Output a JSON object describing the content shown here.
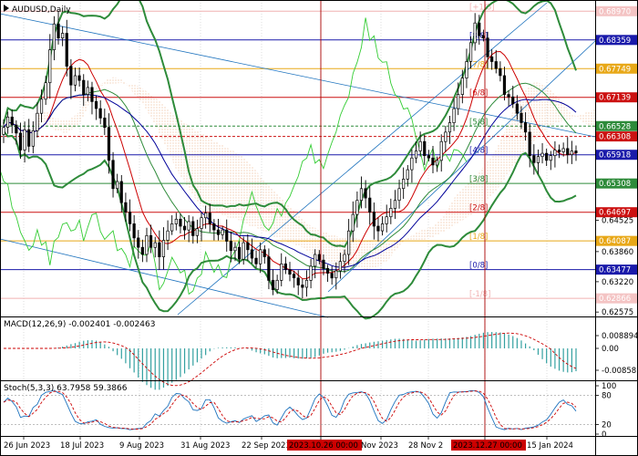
{
  "window": {
    "symbol_title": "AUDUSD,Daily",
    "macd_title": "MACD(12,26,9) -0.002401 -0.002463",
    "stoch_title": "Stoch(5,3,3) 63.7958 59.3866"
  },
  "colors": {
    "grid": "#c8c8c8",
    "bull": "#000000",
    "bear": "#000000",
    "fast_ma": "#cc0000",
    "slow_ma": "#000099",
    "bollinger": "#2e8b3a",
    "chikou": "#33cc33",
    "channel": "#1e73be",
    "cloud": "#e8a070",
    "macd_hist": "#33a0a0",
    "macd_signal": "#cc0000",
    "stoch_main": "#1e73be",
    "stoch_signal": "#cc0000",
    "vline": "#aa0000",
    "date_tag_bg": "#cc0000"
  },
  "price_axis": {
    "ticks": [
      "0.68970",
      "0.68359",
      "0.67749",
      "0.67139",
      "0.66528",
      "0.66308",
      "0.65918",
      "0.65308",
      "0.64697",
      "0.64525",
      "0.64087",
      "0.63860",
      "0.63477",
      "0.63220",
      "0.62866",
      "0.62575"
    ]
  },
  "price_tags": [
    {
      "label": "0.68970",
      "value": 0.6897,
      "bg": "#f4c4c4",
      "fg": "#ffffff"
    },
    {
      "label": "0.68359",
      "value": 0.68359,
      "bg": "#1a1aaa",
      "fg": "#ffffff"
    },
    {
      "label": "0.67749",
      "value": 0.67749,
      "bg": "#e8a818",
      "fg": "#ffffff"
    },
    {
      "label": "0.67139",
      "value": 0.67139,
      "bg": "#cc1111",
      "fg": "#ffffff"
    },
    {
      "label": "0.66528",
      "value": 0.66528,
      "bg": "#2e8b3a",
      "fg": "#ffffff"
    },
    {
      "label": "0.66308",
      "value": 0.66308,
      "bg": "#cc1111",
      "fg": "#ffffff"
    },
    {
      "label": "0.65918",
      "value": 0.65918,
      "bg": "#1a1aaa",
      "fg": "#ffffff"
    },
    {
      "label": "0.65308",
      "value": 0.65308,
      "bg": "#2e8b3a",
      "fg": "#ffffff"
    },
    {
      "label": "0.64697",
      "value": 0.64697,
      "bg": "#cc1111",
      "fg": "#ffffff"
    },
    {
      "label": "0.64087",
      "value": 0.64087,
      "bg": "#e8a818",
      "fg": "#ffffff"
    },
    {
      "label": "0.63477",
      "value": 0.63477,
      "bg": "#1a1aaa",
      "fg": "#ffffff"
    },
    {
      "label": "0.62866",
      "value": 0.62866,
      "bg": "#f4c4c4",
      "fg": "#ffffff"
    }
  ],
  "murrey_levels": [
    {
      "label": "[+1/8]",
      "value": 0.6897,
      "color": "#f0b0b0",
      "style": "solid"
    },
    {
      "label": "[8/8]",
      "value": 0.68359,
      "color": "#1a1aaa",
      "style": "solid"
    },
    {
      "label": "[7/8]",
      "value": 0.67749,
      "color": "#e8a818",
      "style": "solid"
    },
    {
      "label": "[6/8]",
      "value": 0.67139,
      "color": "#cc1111",
      "style": "solid"
    },
    {
      "label": "[5/8]",
      "value": 0.66528,
      "color": "#2e8b3a",
      "style": "dashed"
    },
    {
      "label": "[4/8]",
      "value": 0.65918,
      "color": "#1a1aaa",
      "style": "solid"
    },
    {
      "label": "[3/8]",
      "value": 0.65308,
      "color": "#2e8b3a",
      "style": "solid"
    },
    {
      "label": "[2/8]",
      "value": 0.64697,
      "color": "#cc1111",
      "style": "solid"
    },
    {
      "label": "[1/8]",
      "value": 0.64087,
      "color": "#e8a818",
      "style": "solid"
    },
    {
      "label": "[0/8]",
      "value": 0.63477,
      "color": "#1a1aaa",
      "style": "solid"
    },
    {
      "label": "[-1/8]",
      "value": 0.62866,
      "color": "#f0b0b0",
      "style": "solid"
    }
  ],
  "extra_levels": [
    {
      "value": 0.66308,
      "color": "#cc1111",
      "style": "dashed"
    }
  ],
  "macd_axis": {
    "ticks": [
      "0.008894",
      "0.00",
      "-0.008587"
    ]
  },
  "stoch_axis": {
    "ticks": [
      "100",
      "80",
      "20",
      "0"
    ]
  },
  "time_axis": {
    "labels": [
      "26 Jun 2023",
      "18 Jul 2023",
      "9 Aug 2023",
      "31 Aug 2023",
      "22 Sep 2023",
      "2023.10.26 00:00",
      "Nov 2023",
      "28 Nov 2",
      "2023.12.27 00:00",
      "15 Jan 2024"
    ],
    "highlight_labels": [
      "2023.10.26 00:00",
      "2023.12.27 00:00"
    ]
  },
  "chart_data": {
    "type": "candlestick",
    "symbol": "AUDUSD",
    "timeframe": "Daily",
    "price_range": [
      0.6252,
      0.6915
    ],
    "period": [
      "26 Jun 2023",
      "Jan 2024"
    ],
    "series": [
      {
        "name": "AUDUSD",
        "close": [
          0.665,
          0.6672,
          0.6655,
          0.6638,
          0.6602,
          0.6645,
          0.661,
          0.6643,
          0.668,
          0.671,
          0.6745,
          0.6815,
          0.687,
          0.684,
          0.685,
          0.678,
          0.674,
          0.676,
          0.675,
          0.672,
          0.6735,
          0.6705,
          0.669,
          0.667,
          0.665,
          0.658,
          0.652,
          0.6535,
          0.649,
          0.647,
          0.6445,
          0.6415,
          0.6395,
          0.638,
          0.642,
          0.6395,
          0.6405,
          0.6375,
          0.641,
          0.643,
          0.6445,
          0.6455,
          0.644,
          0.6432,
          0.645,
          0.642,
          0.6435,
          0.6458,
          0.6468,
          0.6445,
          0.6432,
          0.6422,
          0.6432,
          0.6408,
          0.6388,
          0.6395,
          0.637,
          0.6405,
          0.639,
          0.6372,
          0.636,
          0.639,
          0.6375,
          0.6325,
          0.6305,
          0.6325,
          0.636,
          0.6348,
          0.6338,
          0.633,
          0.6315,
          0.631,
          0.6325,
          0.6355,
          0.638,
          0.6368,
          0.635,
          0.634,
          0.633,
          0.6345,
          0.6365,
          0.638,
          0.643,
          0.6465,
          0.6495,
          0.652,
          0.65,
          0.647,
          0.644,
          0.643,
          0.6445,
          0.646,
          0.6478,
          0.6495,
          0.652,
          0.654,
          0.656,
          0.6585,
          0.66,
          0.662,
          0.659,
          0.6585,
          0.657,
          0.658,
          0.662,
          0.664,
          0.666,
          0.669,
          0.672,
          0.6755,
          0.679,
          0.683,
          0.6872,
          0.6845,
          0.684,
          0.68,
          0.679,
          0.6775,
          0.676,
          0.672,
          0.6715,
          0.67,
          0.668,
          0.666,
          0.664,
          0.659,
          0.6575,
          0.6588,
          0.6595,
          0.658,
          0.659,
          0.6602,
          0.6598,
          0.6605,
          0.6592,
          0.66,
          0.6596
        ]
      }
    ]
  }
}
